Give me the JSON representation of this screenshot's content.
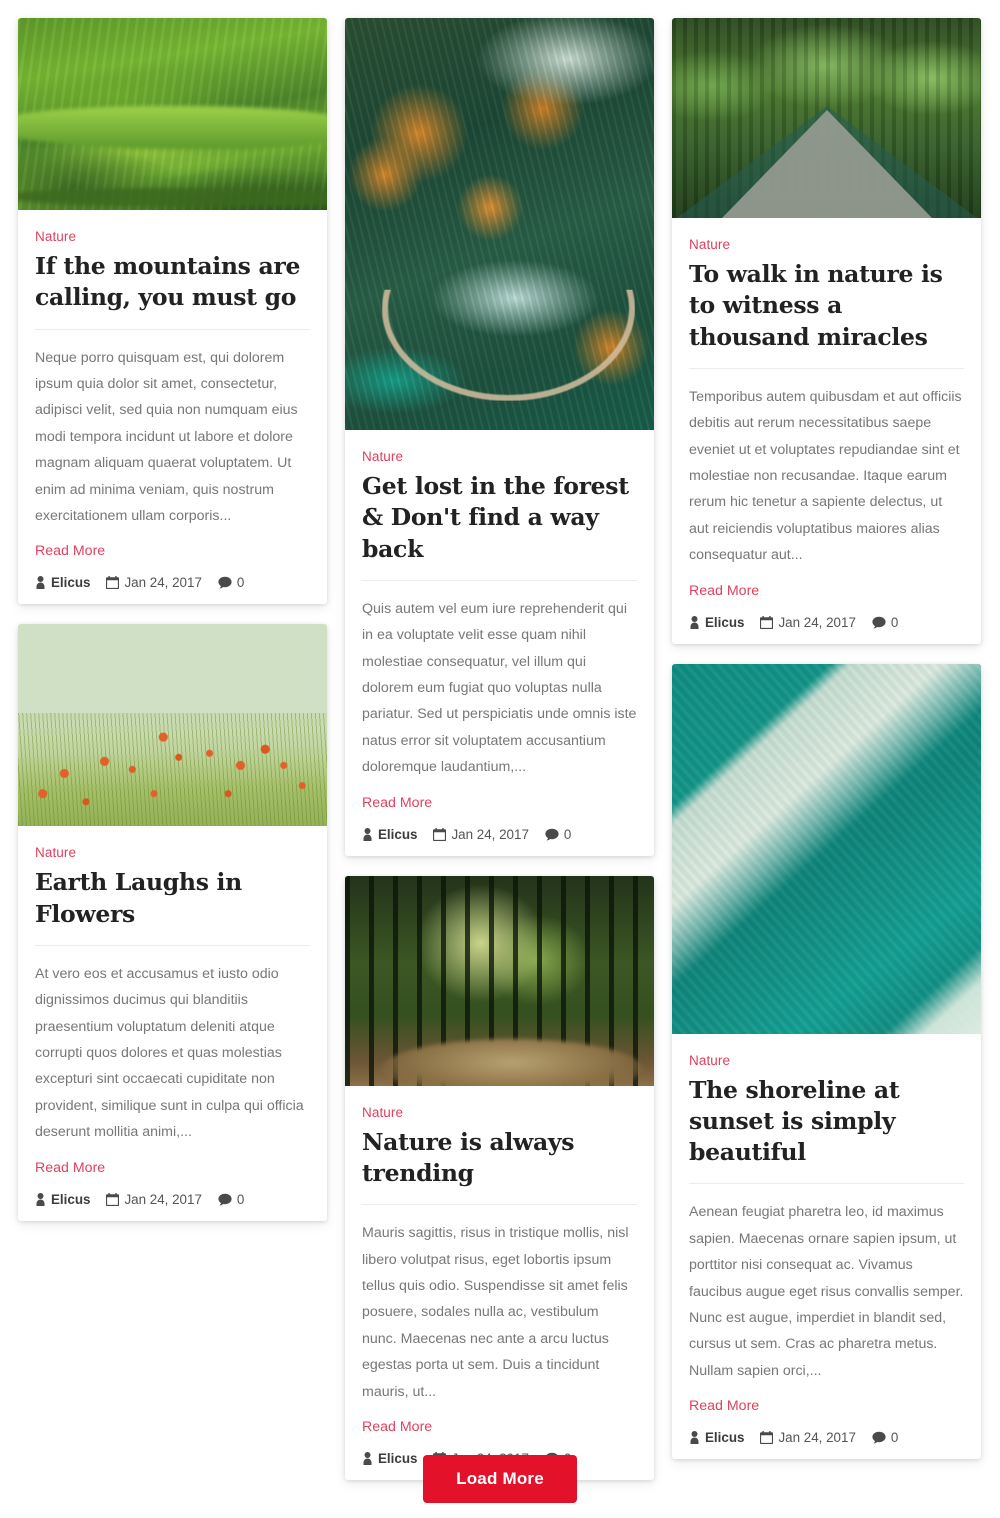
{
  "theme": {
    "accent_red": "#e4112b",
    "category_color": "#e0415f",
    "link_color": "#e0415f",
    "title_color": "#222222",
    "body_color": "#777777",
    "card_bg": "#ffffff",
    "page_bg": "#ffffff"
  },
  "labels": {
    "read_more": "Read More",
    "category": "Nature"
  },
  "load_more": {
    "label": "Load More"
  },
  "posts": [
    {
      "id": "mountains-calling",
      "category": "Nature",
      "title": "If the mountains are calling, you must go",
      "excerpt": "Neque porro quisquam est, qui dolorem ipsum quia dolor sit amet, consectetur, adipisci velit, sed quia non numquam eius modi tempora incidunt ut labore et dolore magnam aliquam quaerat voluptatem. Ut enim ad minima veniam, quis nostrum exercitationem ullam corporis...",
      "read_more": "Read More",
      "author": "Elicus",
      "date": "Jan 24, 2017",
      "comments": "0",
      "image_alt": "green rolling mountain hills"
    },
    {
      "id": "earth-laughs-flowers",
      "category": "Nature",
      "title": "Earth Laughs in Flowers",
      "excerpt": "At vero eos et accusamus et iusto odio dignissimos ducimus qui blanditiis praesentium voluptatum deleniti atque corrupti quos dolores et quas molestias excepturi sint occaecati cupiditate non provident, similique sunt in culpa qui officia deserunt mollitia animi,...",
      "read_more": "Read More",
      "author": "Elicus",
      "date": "Jan 24, 2017",
      "comments": "0",
      "image_alt": "field of orange poppies under pale sky"
    },
    {
      "id": "get-lost-forest",
      "category": "Nature",
      "title": "Get lost in the forest & Don't find a way back",
      "excerpt": "Quis autem vel eum iure reprehenderit qui in ea voluptate velit esse quam nihil molestiae consequatur, vel illum qui dolorem eum fugiat quo voluptas nulla pariatur. Sed ut perspiciatis unde omnis iste natus error sit voluptatem accusantium doloremque laudantium,...",
      "read_more": "Read More",
      "author": "Elicus",
      "date": "Jan 24, 2017",
      "comments": "0",
      "image_alt": "aerial view of forest with turquoise lakes and walkway"
    },
    {
      "id": "nature-always-trending",
      "category": "Nature",
      "title": "Nature is always trending",
      "excerpt": "Mauris sagittis, risus in tristique mollis, nisl libero volutpat risus, eget lobortis ipsum tellus quis odio. Suspendisse sit amet felis posuere, sodales nulla ac, vestibulum nunc. Maecenas nec ante a arcu luctus egestas porta ut sem. Duis a tincidunt mauris, ut...",
      "read_more": "Read More",
      "author": "Elicus",
      "date": "Jan 24, 2017",
      "comments": "0",
      "image_alt": "sunlit path through tall forest trees"
    },
    {
      "id": "walk-in-nature",
      "category": "Nature",
      "title": "To walk in nature is to witness a thousand miracles",
      "excerpt": "Temporibus autem quibusdam et aut officiis debitis aut rerum necessitatibus saepe eveniet ut et voluptates repudiandae sint et molestiae non recusandae. Itaque earum rerum hic tenetur a sapiente delectus, ut aut reiciendis voluptatibus maiores alias consequatur aut...",
      "read_more": "Read More",
      "author": "Elicus",
      "date": "Jan 24, 2017",
      "comments": "0",
      "image_alt": "green metal footbridge through jungle canopy"
    },
    {
      "id": "shoreline-sunset",
      "category": "Nature",
      "title": "The shoreline at sunset is simply beautiful",
      "excerpt": "Aenean feugiat pharetra leo, id maximus sapien. Maecenas ornare sapien ipsum, ut porttitor nisi consequat ac. Vivamus faucibus augue eget risus convallis semper. Nunc est augue, imperdiet in blandit sed, cursus ut sem. Cras ac pharetra metus. Nullam sapien orci,...",
      "read_more": "Read More",
      "author": "Elicus",
      "date": "Jan 24, 2017",
      "comments": "0",
      "image_alt": "aerial turquoise ocean waves with white surf"
    }
  ],
  "icons": {
    "author": "user-icon",
    "date": "calendar-icon",
    "comments": "comment-icon"
  }
}
